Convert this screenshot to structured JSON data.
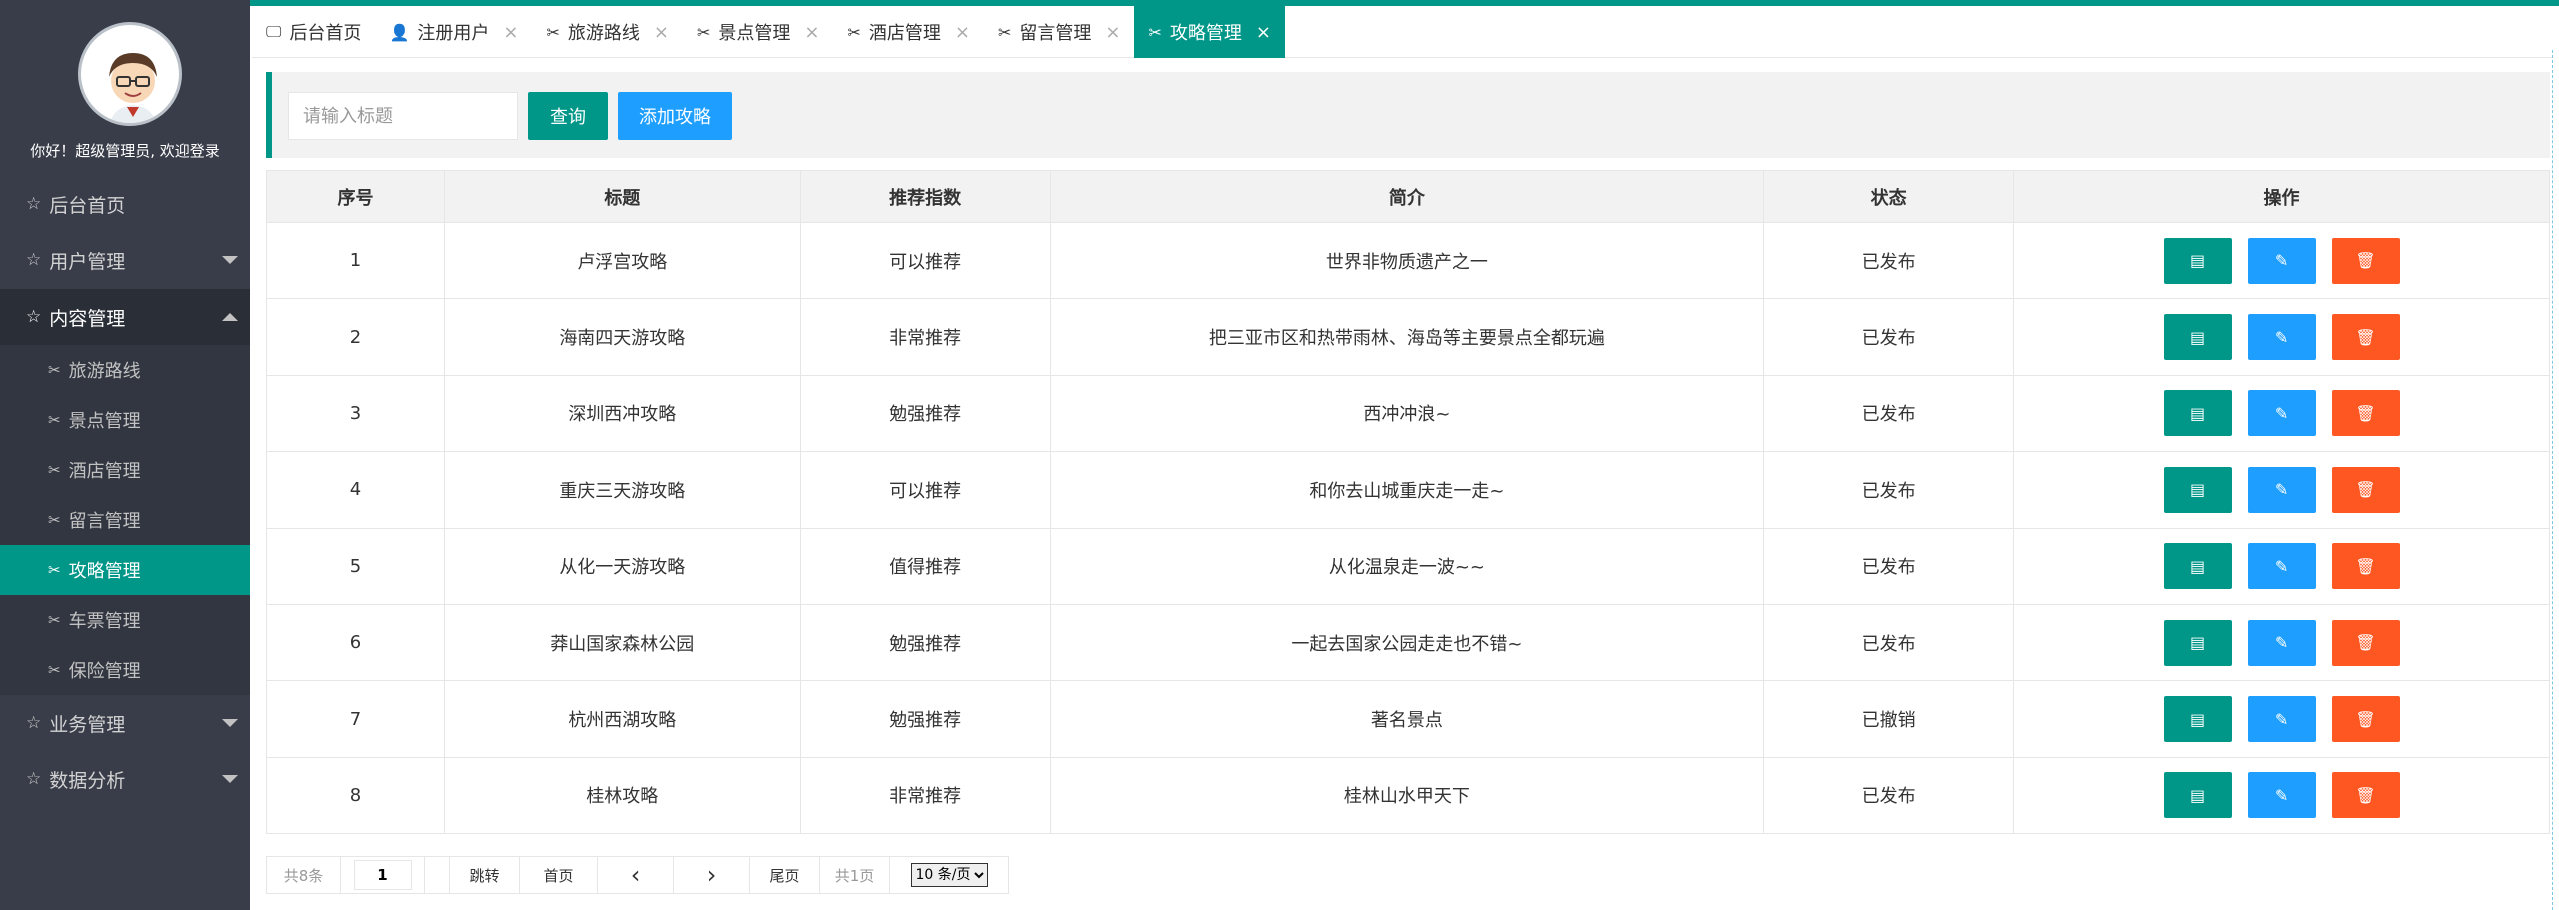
{
  "sidebar": {
    "welcome": "你好！超级管理员, 欢迎登录",
    "menu": [
      {
        "label": "后台首页"
      },
      {
        "label": "用户管理"
      },
      {
        "label": "内容管理"
      },
      {
        "label": "业务管理"
      },
      {
        "label": "数据分析"
      }
    ],
    "sub_items": [
      {
        "label": "旅游路线"
      },
      {
        "label": "景点管理"
      },
      {
        "label": "酒店管理"
      },
      {
        "label": "留言管理"
      },
      {
        "label": "攻略管理"
      },
      {
        "label": "车票管理"
      },
      {
        "label": "保险管理"
      }
    ],
    "active_sub": "攻略管理",
    "accent_color": "#009688"
  },
  "tabs": [
    {
      "label": "后台首页",
      "icon": "monitor-icon"
    },
    {
      "label": "注册用户",
      "icon": "user-icon"
    },
    {
      "label": "旅游路线",
      "icon": "tool-icon"
    },
    {
      "label": "景点管理",
      "icon": "tool-icon"
    },
    {
      "label": "酒店管理",
      "icon": "tool-icon"
    },
    {
      "label": "留言管理",
      "icon": "tool-icon"
    },
    {
      "label": "攻略管理",
      "icon": "tool-icon"
    }
  ],
  "search": {
    "placeholder": "请输入标题",
    "query_label": "查询",
    "add_label": "添加攻略"
  },
  "table": {
    "headers": [
      "序号",
      "标题",
      "推荐指数",
      "简介",
      "状态",
      "操作"
    ],
    "rows": [
      {
        "id": "1",
        "title": "卢浮宫攻略",
        "rating": "可以推荐",
        "intro": "世界非物质遗产之一",
        "status": "已发布"
      },
      {
        "id": "2",
        "title": "海南四天游攻略",
        "rating": "非常推荐",
        "intro": "把三亚市区和热带雨林、海岛等主要景点全都玩遍",
        "status": "已发布"
      },
      {
        "id": "3",
        "title": "深圳西冲攻略",
        "rating": "勉强推荐",
        "intro": "西冲冲浪~",
        "status": "已发布"
      },
      {
        "id": "4",
        "title": "重庆三天游攻略",
        "rating": "可以推荐",
        "intro": "和你去山城重庆走一走~",
        "status": "已发布"
      },
      {
        "id": "5",
        "title": "从化一天游攻略",
        "rating": "值得推荐",
        "intro": "从化温泉走一波~~",
        "status": "已发布"
      },
      {
        "id": "6",
        "title": "莽山国家森林公园",
        "rating": "勉强推荐",
        "intro": "一起去国家公园走走也不错~",
        "status": "已发布"
      },
      {
        "id": "7",
        "title": "杭州西湖攻略",
        "rating": "勉强推荐",
        "intro": "著名景点",
        "status": "已撤销"
      },
      {
        "id": "8",
        "title": "桂林攻略",
        "rating": "非常推荐",
        "intro": "桂林山水甲天下",
        "status": "已发布"
      }
    ],
    "op_colors": {
      "view": "#009688",
      "edit": "#1e9fff",
      "delete": "#ff5722"
    }
  },
  "pager": {
    "total": "共8条",
    "page_value": "1",
    "jump": "跳转",
    "first": "首页",
    "prev": "‹",
    "next": "›",
    "last": "尾页",
    "pages": "共1页",
    "size_option": "10 条/页"
  }
}
